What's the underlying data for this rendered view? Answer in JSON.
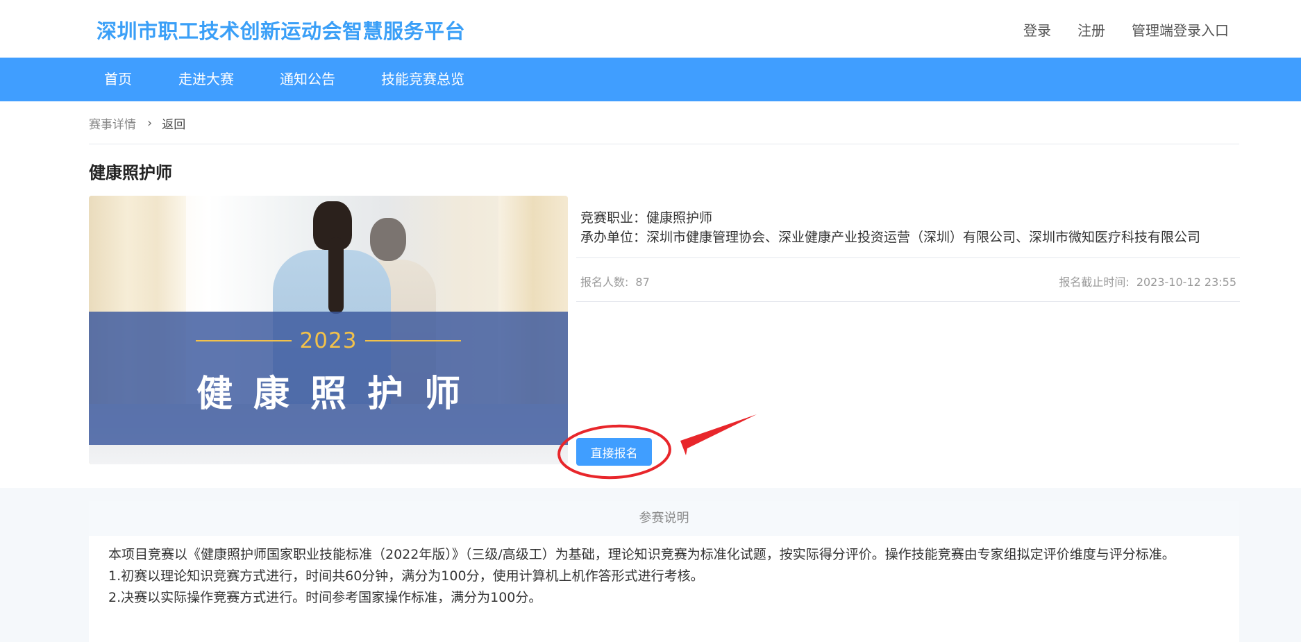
{
  "header": {
    "site_title": "深圳市职工技术创新运动会智慧服务平台",
    "links": {
      "login": "登录",
      "register": "注册",
      "admin_login": "管理端登录入口"
    }
  },
  "nav": {
    "home": "首页",
    "about": "走进大赛",
    "notices": "通知公告",
    "overview": "技能竞赛总览"
  },
  "breadcrumb": {
    "current": "赛事详情",
    "separator": "›",
    "back": "返回"
  },
  "event": {
    "title": "健康照护师",
    "banner": {
      "year": "2023",
      "text": "健康照护师"
    },
    "occupation_label": "竞赛职业：",
    "occupation_value": "健康照护师",
    "organizer_label": "承办单位：",
    "organizer_value": "深圳市健康管理协会、深业健康产业投资运营（深圳）有限公司、深圳市微知医疗科技有限公司",
    "signups_label": "报名人数:",
    "signups_value": "87",
    "deadline_label": "报名截止时间:",
    "deadline_value": "2023-10-12 23:55",
    "signup_button": "直接报名"
  },
  "instructions": {
    "heading": "参赛说明",
    "paragraphs": [
      "本项目竞赛以《健康照护师国家职业技能标准（2022年版）》（三级/高级工）为基础，理论知识竞赛为标准化试题，按实际得分评价。操作技能竞赛由专家组拟定评价维度与评分标准。",
      "1.初赛以理论知识竞赛方式进行，时间共60分钟，满分为100分，使用计算机上机作答形式进行考核。",
      "2.决赛以实际操作竞赛方式进行。时间参考国家操作标准，满分为100分。"
    ]
  },
  "colors": {
    "brand": "#409eff",
    "title_blue": "#3a9ff7",
    "annotation_red": "#e8262b",
    "banner_gold": "#f2c14a"
  },
  "icons": {
    "breadcrumb_separator": "chevron-right-icon"
  }
}
